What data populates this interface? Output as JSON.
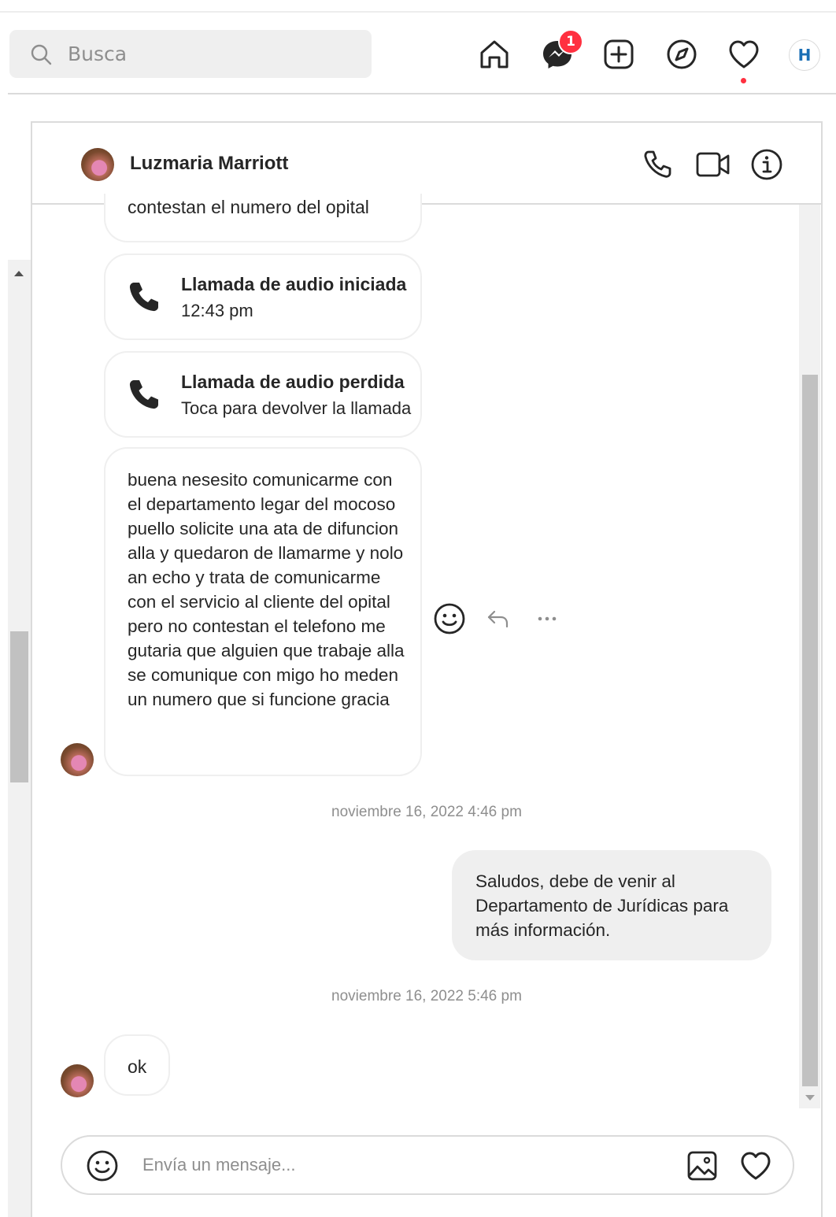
{
  "search": {
    "placeholder": "Busca"
  },
  "nav": {
    "icons": [
      "home-icon",
      "messenger-icon",
      "new-post-icon",
      "explore-icon",
      "activity-heart-icon",
      "profile-avatar"
    ],
    "messages_badge": "1",
    "profile_initial": "H"
  },
  "chat": {
    "contact_name": "Luzmaria Marriott",
    "header_actions": [
      "audio-call-icon",
      "video-call-icon",
      "info-icon"
    ],
    "messages": [
      {
        "type": "received",
        "text": "contestan el numero del opital"
      },
      {
        "type": "call",
        "title": "Llamada de audio iniciada",
        "subtitle": "12:43 pm"
      },
      {
        "type": "call",
        "title": "Llamada de audio perdida",
        "subtitle": "Toca para devolver la llamada"
      },
      {
        "type": "received",
        "text": "buena nesesito comunicarme con el departamento legar del mocoso puello solicite una ata de difuncion alla y quedaron de llamarme y nolo an echo y trata de comunicarme con el servicio al cliente del opital pero no contestan el telefono me gutaria que alguien que trabaje alla se comunique con migo ho meden un numero que si funcione gracia"
      },
      {
        "type": "timestamp",
        "text": "noviembre 16, 2022 4:46 pm"
      },
      {
        "type": "sent",
        "text": "Saludos, debe de venir al Departamento de Jurídicas para más información."
      },
      {
        "type": "timestamp",
        "text": "noviembre 16, 2022 5:46 pm"
      },
      {
        "type": "received",
        "text": "ok"
      }
    ],
    "hover_actions": [
      "react-emoji-icon",
      "reply-icon",
      "more-options-icon"
    ]
  },
  "composer": {
    "placeholder": "Envía un mensaje..."
  },
  "colors": {
    "badge": "#ff3040",
    "border": "#dbdbdb",
    "sent_bubble": "#efefef",
    "muted_text": "#8e8e8e"
  }
}
